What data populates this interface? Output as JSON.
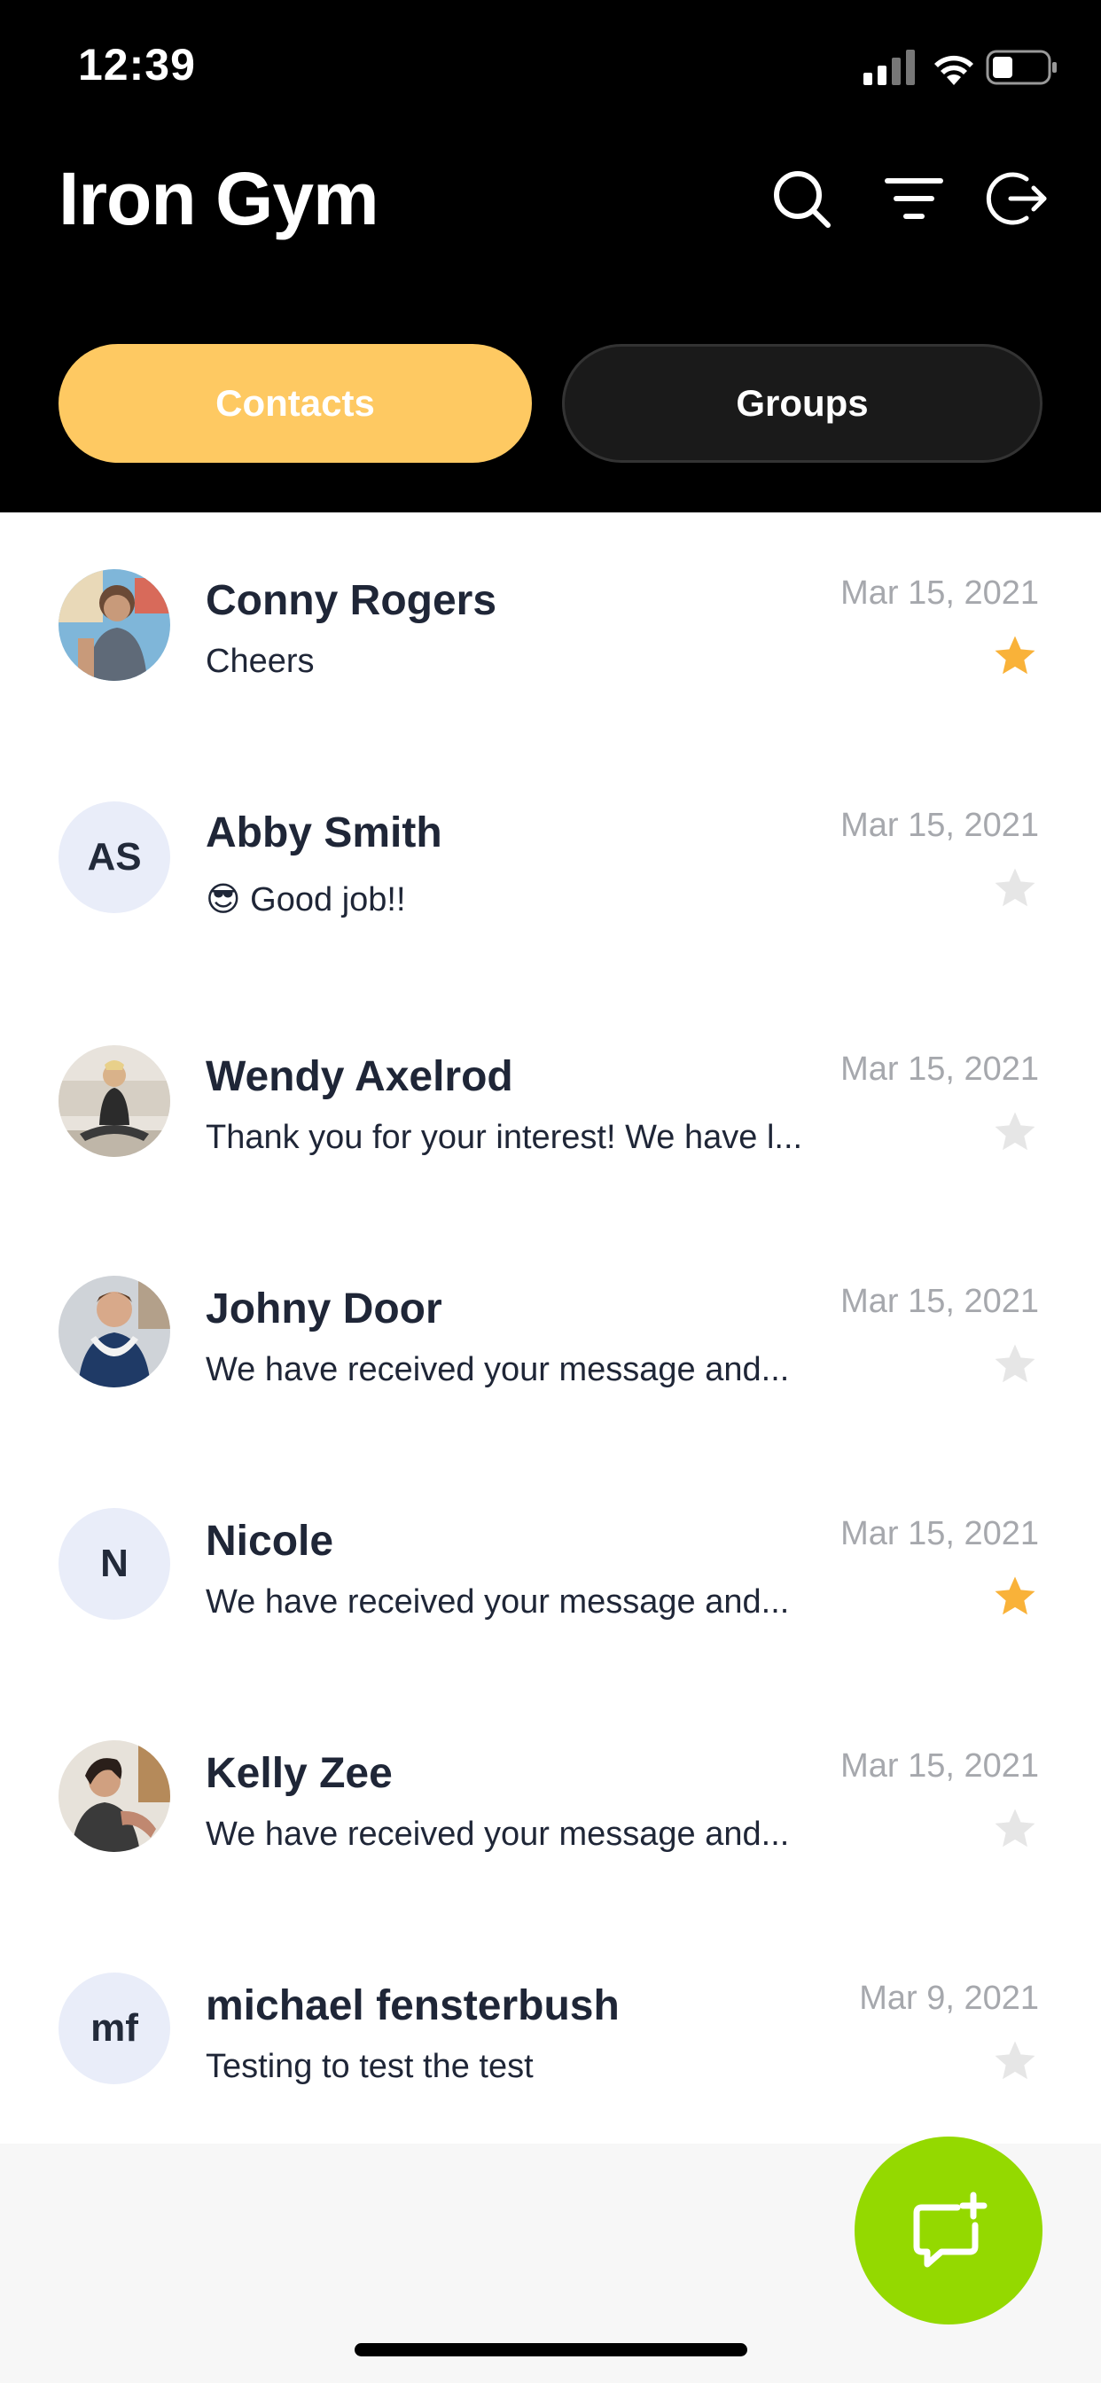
{
  "status_bar": {
    "time": "12:39"
  },
  "header": {
    "title": "Iron Gym",
    "tabs": [
      {
        "label": "Contacts",
        "active": true
      },
      {
        "label": "Groups",
        "active": false
      }
    ]
  },
  "colors": {
    "accent_tab": "#fec962",
    "fab": "#94d900",
    "star_active": "#f9b239",
    "star_inactive": "#e6e6e6"
  },
  "contacts": [
    {
      "name": "Conny Rogers",
      "message": "Cheers",
      "date": "Mar 15, 2021",
      "starred": true,
      "avatar": "photo"
    },
    {
      "name": "Abby Smith",
      "message": "😎 Good job!!",
      "date": "Mar 15, 2021",
      "starred": false,
      "avatar": "initials",
      "initials": "AS"
    },
    {
      "name": "Wendy Axelrod",
      "message": "Thank you for your interest! We have l...",
      "date": "Mar 15, 2021",
      "starred": false,
      "avatar": "photo"
    },
    {
      "name": "Johny Door",
      "message": "We have received your message and...",
      "date": "Mar 15, 2021",
      "starred": false,
      "avatar": "photo"
    },
    {
      "name": "Nicole",
      "message": "We have received your message and...",
      "date": "Mar 15, 2021",
      "starred": true,
      "avatar": "initials",
      "initials": "N"
    },
    {
      "name": "Kelly Zee",
      "message": "We have received your message and...",
      "date": "Mar 15, 2021",
      "starred": false,
      "avatar": "photo"
    },
    {
      "name": "michael fensterbush",
      "message": "Testing to test the test",
      "date": "Mar 9, 2021",
      "starred": false,
      "avatar": "initials",
      "initials": "mf"
    }
  ]
}
